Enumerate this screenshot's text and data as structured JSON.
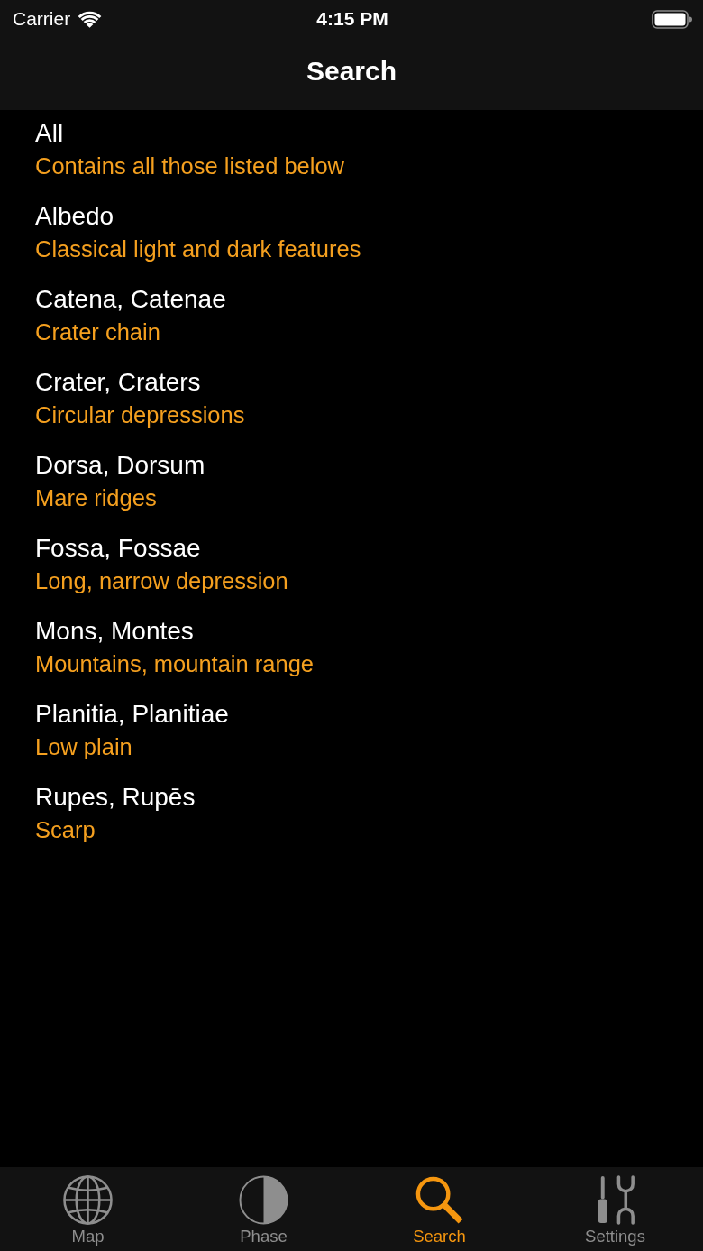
{
  "status_bar": {
    "carrier": "Carrier",
    "time": "4:15 PM"
  },
  "nav_bar": {
    "title": "Search"
  },
  "items": [
    {
      "title": "All",
      "subtitle": "Contains all those listed below"
    },
    {
      "title": "Albedo",
      "subtitle": "Classical light and dark features"
    },
    {
      "title": "Catena, Catenae",
      "subtitle": "Crater chain"
    },
    {
      "title": "Crater, Craters",
      "subtitle": "Circular depressions"
    },
    {
      "title": "Dorsa, Dorsum",
      "subtitle": "Mare ridges"
    },
    {
      "title": "Fossa, Fossae",
      "subtitle": "Long, narrow depression"
    },
    {
      "title": "Mons, Montes",
      "subtitle": "Mountains, mountain range"
    },
    {
      "title": "Planitia, Planitiae",
      "subtitle": "Low plain"
    },
    {
      "title": "Rupes, Rupēs",
      "subtitle": "Scarp"
    }
  ],
  "tabs": [
    {
      "label": "Map",
      "selected": false
    },
    {
      "label": "Phase",
      "selected": false
    },
    {
      "label": "Search",
      "selected": true
    },
    {
      "label": "Settings",
      "selected": false
    }
  ]
}
